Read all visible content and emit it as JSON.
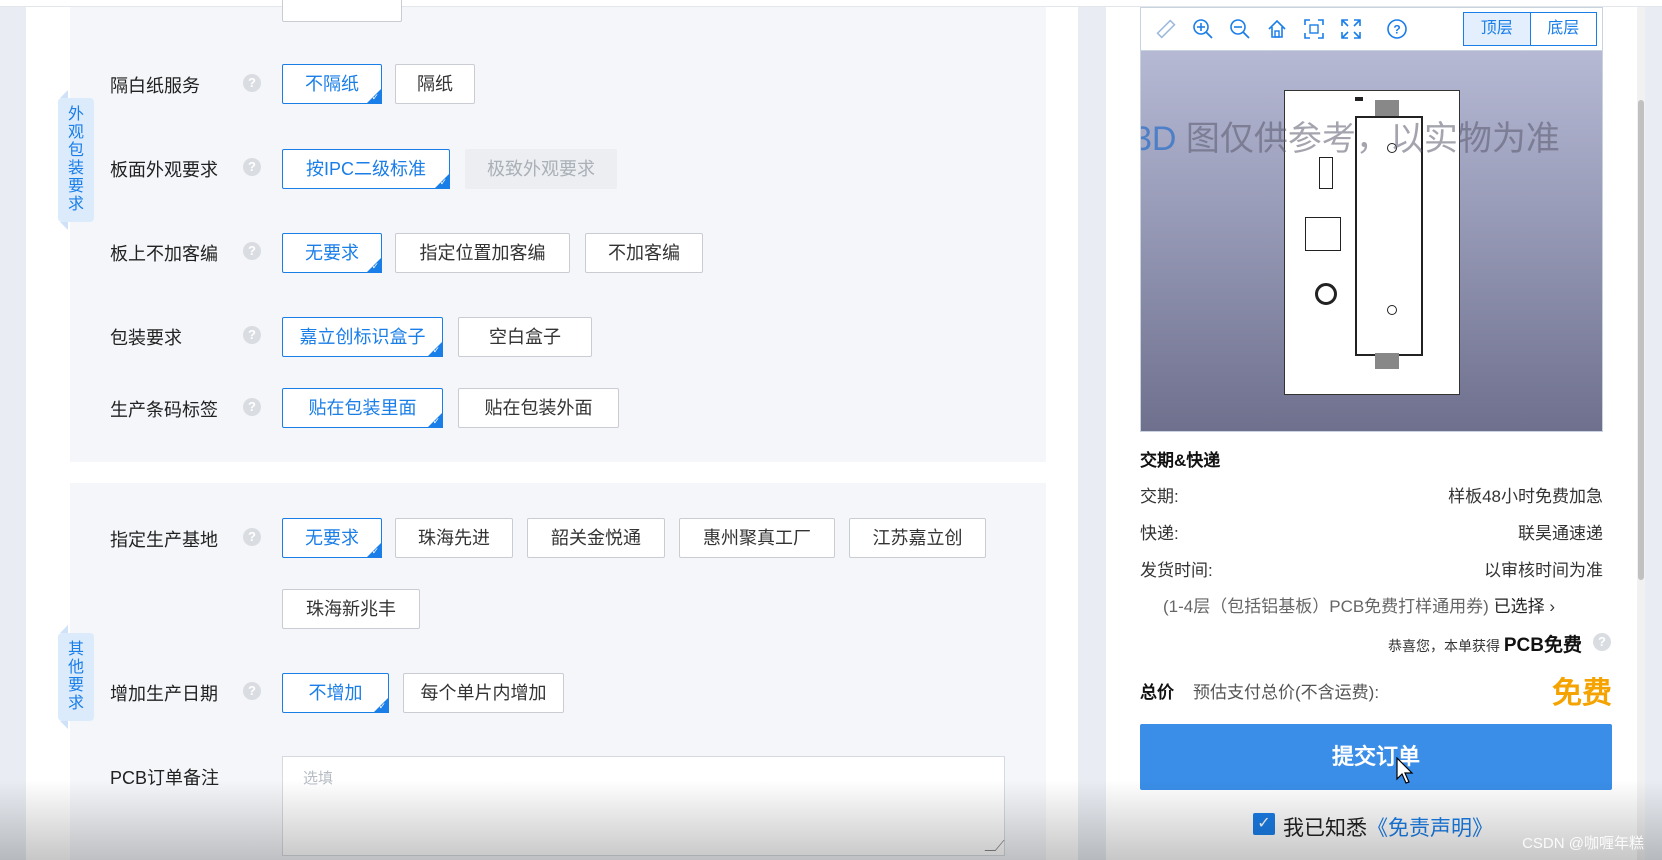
{
  "appearance_tag": [
    "外",
    "观",
    "包",
    "装",
    "要",
    "求"
  ],
  "other_tag": [
    "其",
    "他",
    "要",
    "求"
  ],
  "rows": {
    "white_paper": {
      "label": "隔白纸服务",
      "options": [
        "不隔纸",
        "隔纸"
      ]
    },
    "board_look": {
      "label": "板面外观要求",
      "options": [
        "按IPC二级标准",
        "极致外观要求"
      ]
    },
    "customer_code": {
      "label": "板上不加客编",
      "options": [
        "无要求",
        "指定位置加客编",
        "不加客编"
      ]
    },
    "packaging": {
      "label": "包装要求",
      "options": [
        "嘉立创标识盒子",
        "空白盒子"
      ]
    },
    "barcode": {
      "label": "生产条码标签",
      "options": [
        "贴在包装里面",
        "贴在包装外面"
      ]
    },
    "base": {
      "label": "指定生产基地",
      "options": [
        "无要求",
        "珠海先进",
        "韶关金悦通",
        "惠州聚真工厂",
        "江苏嘉立创",
        "珠海新兆丰"
      ]
    },
    "prod_date": {
      "label": "增加生产日期",
      "options": [
        "不增加",
        "每个单片内增加"
      ]
    },
    "remark": {
      "label": "PCB订单备注",
      "placeholder": "选填"
    }
  },
  "help_mark": "?",
  "check_mark": "✓",
  "viewer": {
    "layers": [
      "顶层",
      "底层"
    ],
    "watermark_prefix": "3D",
    "watermark_text": " 图仅供参考，以实物为准"
  },
  "delivery": {
    "title": "交期&快递",
    "items": [
      {
        "label": "交期:",
        "value": "样板48小时免费加急"
      },
      {
        "label": "快递:",
        "value": "联昊通速递"
      },
      {
        "label": "发货时间:",
        "value": "以审核时间为准"
      }
    ],
    "coupon": "(1-4层（包括铝基板）PCB免费打样通用券)",
    "coupon_status": "已选择",
    "congrats_prefix": "恭喜您，本单获得",
    "congrats_value": "PCB免费"
  },
  "total": {
    "label": "总价",
    "sub": "预估支付总价(不含运费):",
    "value": "免费"
  },
  "submit_label": "提交订单",
  "agree": {
    "prefix": "我已知悉",
    "link": "《免责声明》"
  },
  "watermark_site": "CSDN @咖喱年糕",
  "colors": {
    "accent": "#1a7ee8",
    "price": "#f5a300",
    "submit": "#3a8ee8"
  }
}
